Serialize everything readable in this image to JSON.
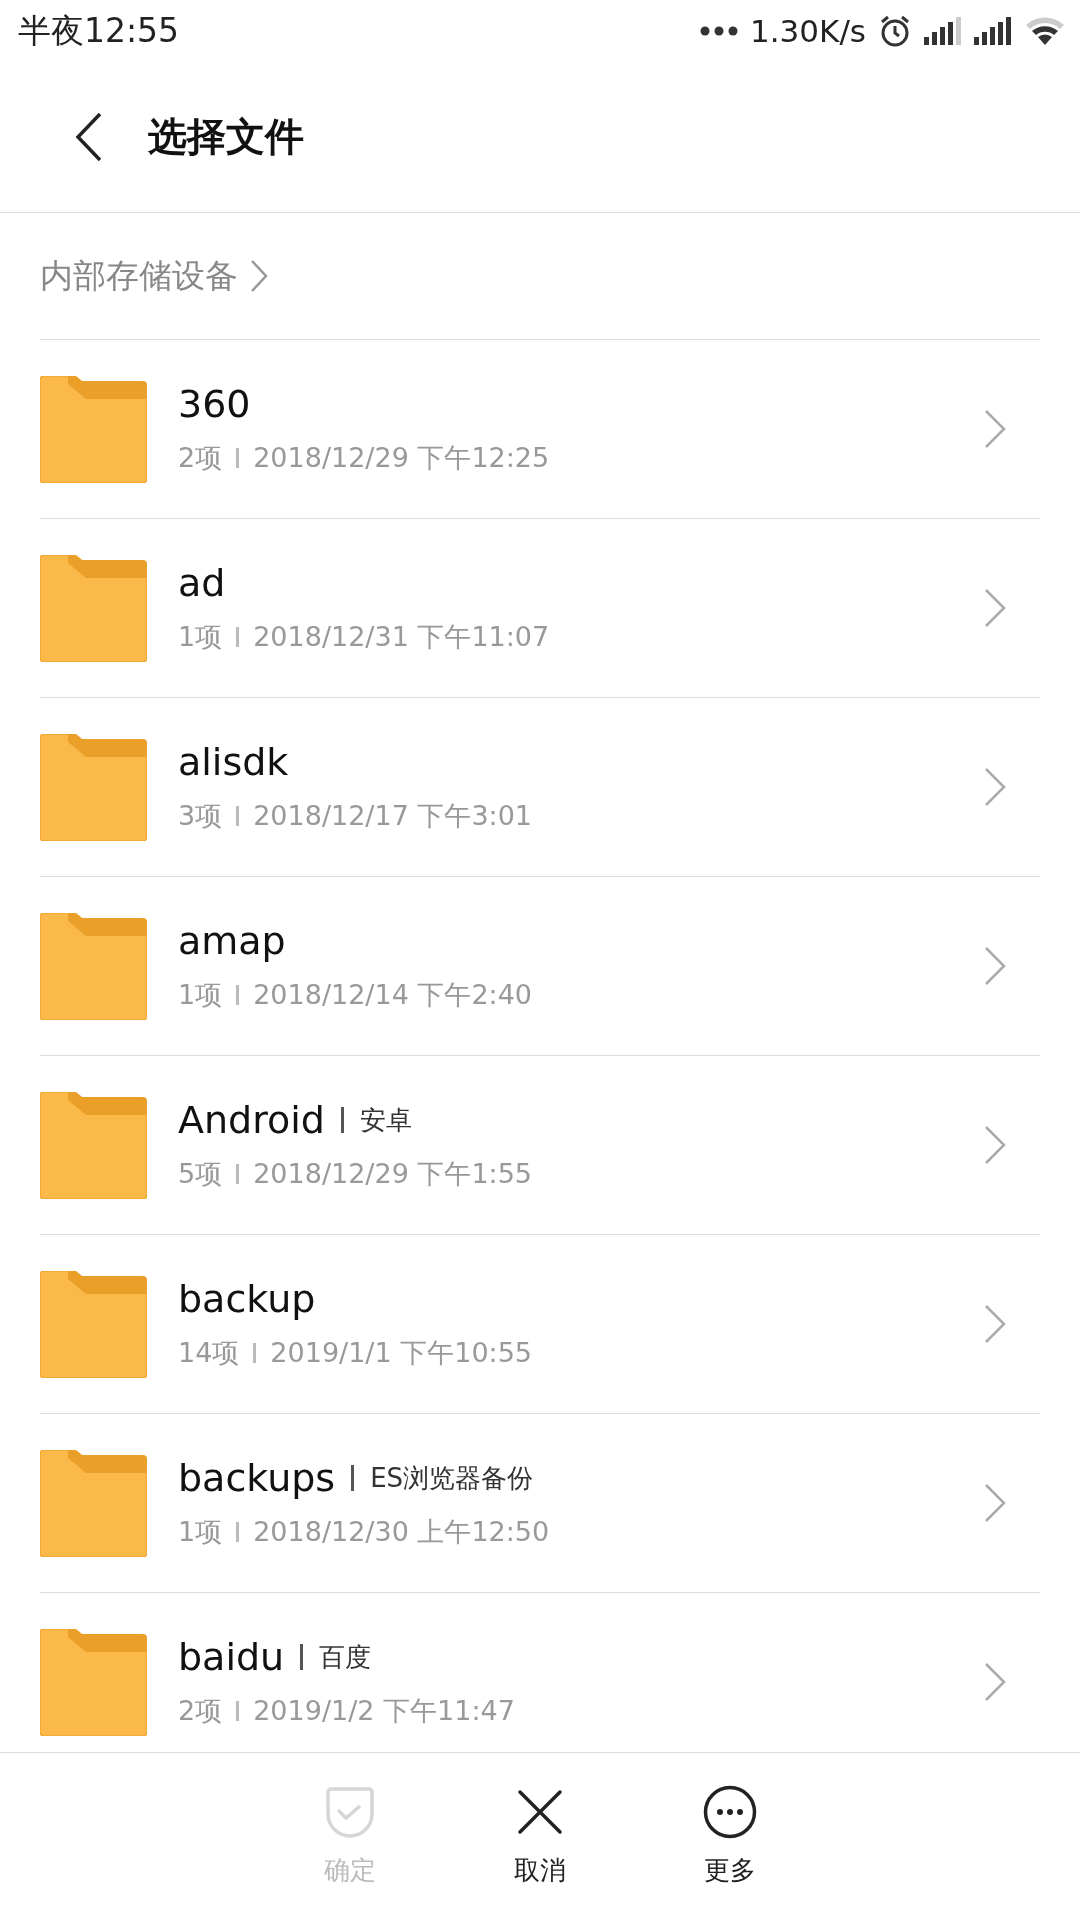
{
  "status_bar": {
    "time": "半夜12:55",
    "speed": "1.30K/s"
  },
  "header": {
    "title": "选择文件"
  },
  "breadcrumb": {
    "label": "内部存储设备"
  },
  "folders": [
    {
      "name": "360",
      "count": "2项",
      "date": "2018/12/29 下午12:25"
    },
    {
      "name": "ad",
      "count": "1项",
      "date": "2018/12/31 下午11:07"
    },
    {
      "name": "alisdk",
      "count": "3项",
      "date": "2018/12/17 下午3:01"
    },
    {
      "name": "amap",
      "count": "1项",
      "date": "2018/12/14 下午2:40"
    },
    {
      "name": "Android",
      "alias": "安卓",
      "count": "5项",
      "date": "2018/12/29 下午1:55"
    },
    {
      "name": "backup",
      "count": "14项",
      "date": "2019/1/1 下午10:55"
    },
    {
      "name": "backups",
      "alias": "ES浏览器备份",
      "count": "1项",
      "date": "2018/12/30 上午12:50"
    },
    {
      "name": "baidu",
      "alias": "百度",
      "count": "2项",
      "date": "2019/1/2 下午11:47"
    }
  ],
  "actions": [
    {
      "kind": "confirm",
      "label": "确定",
      "disabled": true
    },
    {
      "kind": "cancel",
      "label": "取消",
      "disabled": false
    },
    {
      "kind": "more",
      "label": "更多",
      "disabled": false
    }
  ]
}
